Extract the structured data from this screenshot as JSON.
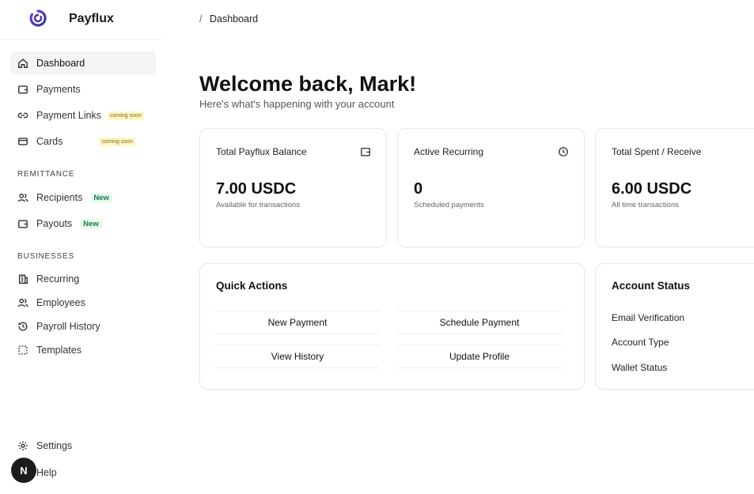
{
  "brand": {
    "name": "Payflux",
    "logo_icon": "payflux-logo-icon"
  },
  "breadcrumb": {
    "separator": "/",
    "current": "Dashboard"
  },
  "sidebar": {
    "items": [
      {
        "label": "Dashboard",
        "icon": "home-icon",
        "active": true
      },
      {
        "label": "Payments",
        "icon": "wallet-icon"
      },
      {
        "label": "Payment Links",
        "icon": "link-icon",
        "badge": "coming soon"
      },
      {
        "label": "Cards",
        "icon": "card-icon",
        "badge": "coming soon"
      }
    ],
    "remittance_label": "REMITTANCE",
    "remittance": [
      {
        "label": "Recipients",
        "icon": "users-icon",
        "badge": "New"
      },
      {
        "label": "Payouts",
        "icon": "wallet-icon",
        "badge": "New"
      }
    ],
    "businesses_label": "BUSINESSES",
    "businesses": [
      {
        "label": "Recurring",
        "icon": "building-icon"
      },
      {
        "label": "Employees",
        "icon": "users-icon"
      },
      {
        "label": "Payroll History",
        "icon": "history-icon"
      },
      {
        "label": "Templates",
        "icon": "template-icon"
      }
    ],
    "footer": [
      {
        "label": "Settings",
        "icon": "gear-icon"
      },
      {
        "label": "Help",
        "icon": "help-icon"
      }
    ],
    "avatar_letter": "N"
  },
  "main": {
    "welcome": "Welcome back, Mark!",
    "subtitle": "Here's what's happening with your account",
    "stats": [
      {
        "title": "Total Payflux Balance",
        "value": "7.00 USDC",
        "caption": "Available for transactions",
        "icon": "wallet-icon"
      },
      {
        "title": "Active Recurring",
        "value": "0",
        "caption": "Scheduled payments",
        "icon": "clock-icon"
      },
      {
        "title": "Total Spent / Receive",
        "value": "6.00 USDC",
        "caption": "All time transactions"
      }
    ],
    "quick_actions": {
      "title": "Quick Actions",
      "buttons": [
        "New Payment",
        "Schedule Payment",
        "View History",
        "Update Profile"
      ]
    },
    "account_status": {
      "title": "Account Status",
      "rows": [
        "Email Verification",
        "Account Type",
        "Wallet Status"
      ]
    }
  }
}
